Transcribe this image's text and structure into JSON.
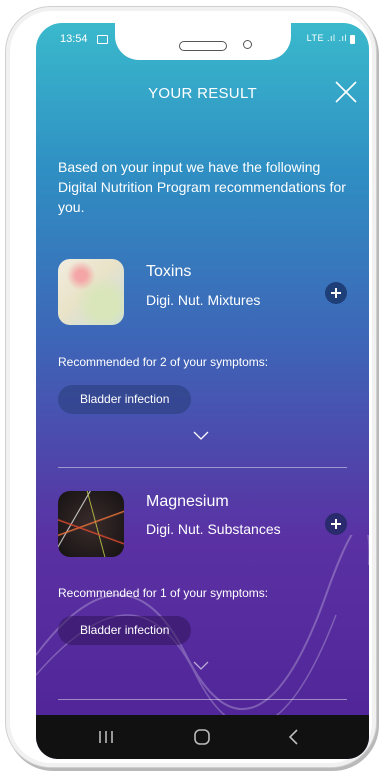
{
  "status_bar": {
    "time": "13:54",
    "signal_text": "LTE .ıl .ıl"
  },
  "header": {
    "title": "YOUR RESULT"
  },
  "intro": {
    "text": "Based on your input we have the following Digital Nutrition Program recommendations for you."
  },
  "recommendations": [
    {
      "title": "Toxins",
      "category": "Digi. Nut. Mixtures",
      "recommended_text": "Recommended for 2 of your symptoms:",
      "symptom": "Bladder infection"
    },
    {
      "title": "Magnesium",
      "category": "Digi. Nut. Substances",
      "recommended_text": "Recommended for 1 of your symptoms:",
      "symptom": "Bladder infection"
    }
  ],
  "icons": {
    "close": "close-icon",
    "add": "plus-circle-icon",
    "expand": "chevron-down-icon",
    "nav_recents": "recents-icon",
    "nav_home": "home-icon",
    "nav_back": "back-icon"
  },
  "colors": {
    "gradient_top": "#3ab9cc",
    "gradient_mid": "#3f62b6",
    "gradient_bottom": "#4f2396",
    "nav_bar": "#111111"
  }
}
